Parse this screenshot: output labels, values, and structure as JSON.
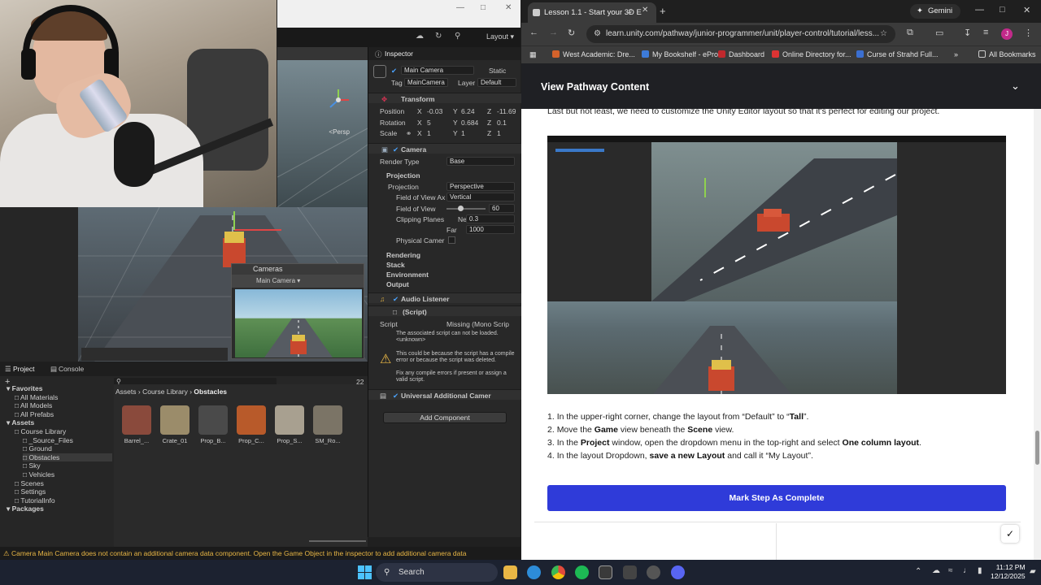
{
  "unity": {
    "layout_label": "Layout",
    "scene": {
      "persp_label": "<Persp"
    },
    "cameras_overlay": {
      "title": "Cameras",
      "selected": "Main Camera"
    },
    "inspector": {
      "tab": "Inspector",
      "object_name": "Main Camera",
      "static_label": "Static",
      "tag_label": "Tag",
      "tag_value": "MainCamera",
      "layer_label": "Layer",
      "layer_value": "Default",
      "transform": {
        "title": "Transform",
        "position_label": "Position",
        "rotation_label": "Rotation",
        "scale_label": "Scale",
        "pos_x": "-0.03",
        "pos_y": "6.24",
        "pos_z": "-11.69",
        "rot_x": "5",
        "rot_y": "0.684",
        "rot_z": "0.1",
        "scale_x": "1",
        "scale_y": "1",
        "scale_z": "1"
      },
      "camera": {
        "title": "Camera",
        "render_type_label": "Render Type",
        "render_type_value": "Base",
        "projection_section": "Projection",
        "projection_label": "Projection",
        "projection_value": "Perspective",
        "fov_axis_label": "Field of View Ax",
        "fov_axis_value": "Vertical",
        "fov_label": "Field of View",
        "fov_value": "60",
        "clipping_label": "Clipping Planes",
        "near_label": "Near",
        "near_value": "0.3",
        "far_label": "Far",
        "far_value": "1000",
        "physical_label": "Physical Camer",
        "rendering": "Rendering",
        "stack": "Stack",
        "environment": "Environment",
        "output": "Output"
      },
      "audio_listener": "Audio Listener",
      "script_section": "(Script)",
      "script_label": "Script",
      "script_value": "Missing (Mono Scrip",
      "warn_line1": "The associated script can not be loaded.",
      "warn_line2": "<unknown>",
      "warn_line3": "This could be because the script has a compile error or because the script was deleted.",
      "warn_line4": "Fix any compile errors if present or assign a valid script.",
      "universal": "Universal Additional Camer",
      "add_component": "Add Component"
    },
    "project": {
      "tab_project": "Project",
      "tab_console": "Console",
      "count": "22",
      "breadcrumb": [
        "Assets",
        "Course Library",
        "Obstacles"
      ],
      "tree": [
        {
          "label": "Favorites",
          "indent": 0,
          "bold": true
        },
        {
          "label": "All Materials",
          "indent": 1
        },
        {
          "label": "All Models",
          "indent": 1
        },
        {
          "label": "All Prefabs",
          "indent": 1
        },
        {
          "label": "Assets",
          "indent": 0,
          "bold": true
        },
        {
          "label": "Course Library",
          "indent": 1
        },
        {
          "label": "_Source_Files",
          "indent": 2
        },
        {
          "label": "Ground",
          "indent": 2
        },
        {
          "label": "Obstacles",
          "indent": 2
        },
        {
          "label": "Sky",
          "indent": 2
        },
        {
          "label": "Vehicles",
          "indent": 2
        },
        {
          "label": "Scenes",
          "indent": 1
        },
        {
          "label": "Settings",
          "indent": 1
        },
        {
          "label": "TutorialInfo",
          "indent": 1
        },
        {
          "label": "Packages",
          "indent": 0,
          "bold": true
        }
      ],
      "assets": [
        {
          "label": "Barrel_...",
          "color": "#8a4a3c"
        },
        {
          "label": "Crate_01",
          "color": "#9b8c6a"
        },
        {
          "label": "Prop_B...",
          "color": "#4a4a4a"
        },
        {
          "label": "Prop_C...",
          "color": "#b85a2a"
        },
        {
          "label": "Prop_S...",
          "color": "#a8a090"
        },
        {
          "label": "SM_Ro...",
          "color": "#7b7466"
        }
      ]
    },
    "status_message": "Camera Main Camera does not contain an additional camera data component. Open the Game Object in the inspector to add additional camera data"
  },
  "browser": {
    "tab_title": "Lesson 1.1 - Start your 3D E",
    "gemini_label": "Gemini",
    "url": "learn.unity.com/pathway/junior-programmer/unit/player-control/tutorial/less...",
    "bookmarks": [
      {
        "label": "West Academic: Dre...",
        "color": "#d4622b"
      },
      {
        "label": "My Bookshelf - ePro...",
        "color": "#3d7bd9"
      },
      {
        "label": "Dashboard",
        "color": "#c0282d",
        "letter": "C"
      },
      {
        "label": "Online Directory for...",
        "color": "#d33"
      },
      {
        "label": "Curse of Strahd Full...",
        "color": "#3b6fd1"
      }
    ],
    "all_bookmarks": "All Bookmarks",
    "pathway_title": "View Pathway Content",
    "intro": "Last but not least, we need to customize the Unity Editor layout so that it's perfect for editing our project.",
    "steps": [
      {
        "num": "1.",
        "pre": "In the upper-right corner, change the layout from “Default” to “",
        "bold": "Tall",
        "post": "”."
      },
      {
        "num": "2.",
        "pre": "Move the ",
        "bold": "Game",
        "mid": " view beneath the ",
        "bold2": "Scene",
        "post": " view."
      },
      {
        "num": "3.",
        "pre": "In the ",
        "bold": "Project",
        "mid": " window, open the dropdown menu in the top-right and select ",
        "bold2": "One column layout",
        "post": "."
      },
      {
        "num": "4.",
        "pre": "In the layout Dropdown, ",
        "bold": "save a new Layout",
        "post": " and call it “My Layout”."
      }
    ],
    "mark_complete": "Mark Step As Complete",
    "accent": "#2f3bd9"
  },
  "taskbar": {
    "search_label": "Search",
    "time": "11:12 PM",
    "date": "12/12/2025"
  }
}
